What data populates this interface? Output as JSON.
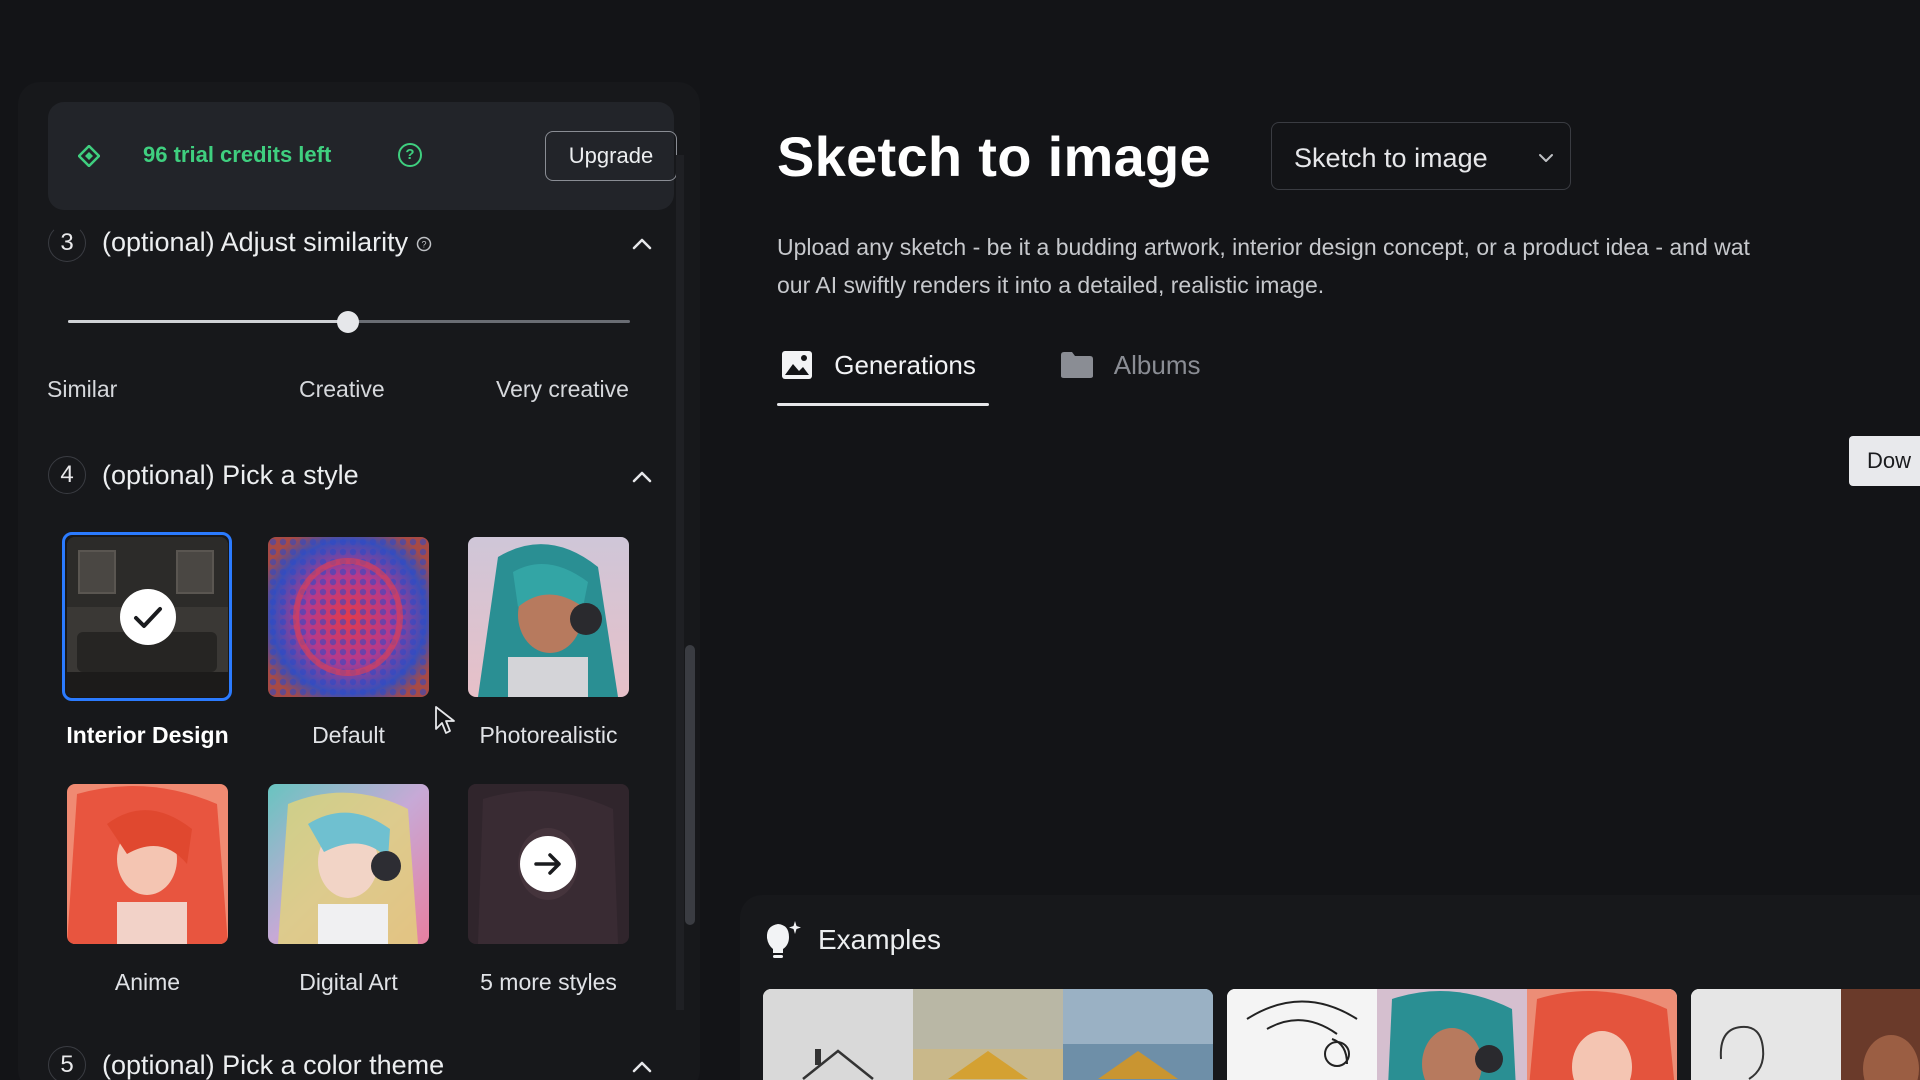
{
  "credits": {
    "text": "96 trial credits left",
    "help_symbol": "?",
    "upgrade_label": "Upgrade"
  },
  "similarity": {
    "step": "3",
    "title": "(optional) Adjust similarity",
    "value": 0.5,
    "labels": [
      "Similar",
      "Creative",
      "Very creative"
    ]
  },
  "style": {
    "step": "4",
    "title": "(optional) Pick a style",
    "selected": "Interior Design",
    "options": [
      "Interior Design",
      "Default",
      "Photorealistic",
      "Anime",
      "Digital Art",
      "5 more styles"
    ]
  },
  "color_theme": {
    "step": "5",
    "title": "(optional) Pick a color theme"
  },
  "main": {
    "title": "Sketch to image",
    "dropdown_value": "Sketch to image",
    "description_line1": "Upload any sketch - be it a budding artwork, interior design concept, or a product idea - and wat",
    "description_line2": "our AI swiftly renders it into a detailed, realistic image.",
    "tabs": [
      {
        "label": "Generations",
        "active": true
      },
      {
        "label": "Albums",
        "active": false
      }
    ],
    "download_label": "Dow"
  },
  "examples": {
    "label": "Examples"
  },
  "colors": {
    "accent_green": "#3fcf7f",
    "selection_blue": "#2b7bff",
    "background": "#131417"
  },
  "icons": [
    "diamond-icon",
    "help-icon",
    "chevron-up-icon",
    "checkmark-icon",
    "arrow-right-icon",
    "chevron-down-icon",
    "image-icon",
    "folder-icon",
    "lightbulb-icon"
  ]
}
